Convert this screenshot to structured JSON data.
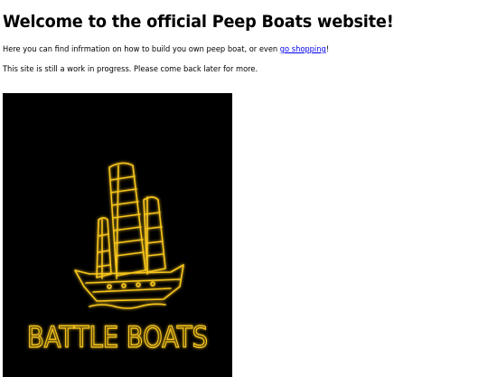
{
  "page": {
    "heading": "Welcome to the official Peep Boats website!",
    "intro_before_link": "Here you can find infrmation on how to build you own peep boat, or even ",
    "intro_link": "go shopping",
    "intro_after_link": "!",
    "notice": "This site is still a work in progress. Please come back later for more."
  },
  "logo": {
    "text": "BATTLE BOATS",
    "glow_color": "#f7c51f",
    "background": "#000000",
    "icon": "junk-ship-icon"
  }
}
